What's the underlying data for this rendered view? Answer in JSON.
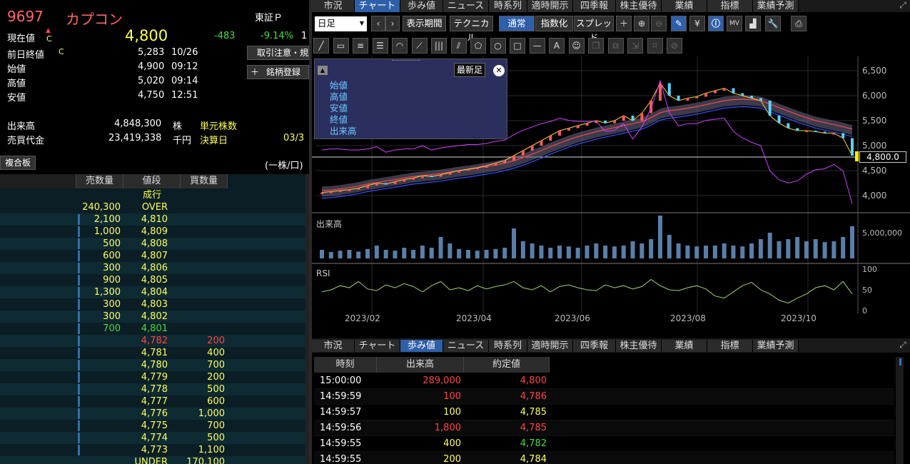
{
  "quote": {
    "code": "9697",
    "name": "カプコン",
    "market": "東証Ｐ",
    "current_label": "現在値",
    "current_marker": "C",
    "current": "4,800",
    "change": "-483",
    "pct": "-9.14%",
    "pct_extra": "1",
    "prev_label": "前日終値",
    "prev_marker": "C",
    "prev": "5,283",
    "prev_date": "10/26",
    "open_label": "始値",
    "open": "4,900",
    "open_time": "09:12",
    "high_label": "高値",
    "high": "5,020",
    "high_time": "09:14",
    "low_label": "安値",
    "low": "4,750",
    "low_time": "12:51",
    "volume_label": "出来高",
    "volume": "4,848,300",
    "volume_unit": "株",
    "unit_label": "単元株数",
    "turnover_label": "売買代金",
    "turnover": "23,419,338",
    "turnover_unit": "千円",
    "fiscal_label": "決算日",
    "fiscal": "03/3"
  },
  "side_buttons": {
    "caution": "取引注意・規",
    "register": "銘柄登録"
  },
  "orderbook": {
    "title": "複合板",
    "unit": "(一株/口)",
    "headers": [
      "売数量",
      "値段",
      "買数量"
    ],
    "market_label": "成行",
    "rows": [
      {
        "sell": "240,300",
        "price": "OVER",
        "buy": "",
        "bar": 0,
        "c": "yl"
      },
      {
        "sell": "2,100",
        "price": "4,810",
        "buy": "",
        "bar": 0.02,
        "c": "yl"
      },
      {
        "sell": "1,000",
        "price": "4,809",
        "buy": "",
        "bar": 0.02,
        "c": "yl"
      },
      {
        "sell": "500",
        "price": "4,808",
        "buy": "",
        "bar": 0.02,
        "c": "yl"
      },
      {
        "sell": "600",
        "price": "4,807",
        "buy": "",
        "bar": 0.02,
        "c": "yl"
      },
      {
        "sell": "300",
        "price": "4,806",
        "buy": "",
        "bar": 0.02,
        "c": "yl"
      },
      {
        "sell": "900",
        "price": "4,805",
        "buy": "",
        "bar": 0.02,
        "c": "yl"
      },
      {
        "sell": "1,300",
        "price": "4,804",
        "buy": "",
        "bar": 0.02,
        "c": "yl"
      },
      {
        "sell": "300",
        "price": "4,803",
        "buy": "",
        "bar": 0.02,
        "c": "yl"
      },
      {
        "sell": "300",
        "price": "4,802",
        "buy": "",
        "bar": 0.02,
        "c": "yl"
      },
      {
        "sell": "700",
        "price": "4,801",
        "buy": "",
        "bar": 0.05,
        "c": "gr"
      },
      {
        "sell": "",
        "price": "4,782",
        "buy": "200",
        "bar": 0.01,
        "c": "rd"
      },
      {
        "sell": "",
        "price": "4,781",
        "buy": "400",
        "bar": 0.02,
        "c": "yl"
      },
      {
        "sell": "",
        "price": "4,780",
        "buy": "700",
        "bar": 0.05,
        "c": "yl"
      },
      {
        "sell": "",
        "price": "4,779",
        "buy": "200",
        "bar": 0.01,
        "c": "yl"
      },
      {
        "sell": "",
        "price": "4,778",
        "buy": "500",
        "bar": 0.02,
        "c": "yl"
      },
      {
        "sell": "",
        "price": "4,777",
        "buy": "600",
        "bar": 0.02,
        "c": "yl"
      },
      {
        "sell": "",
        "price": "4,776",
        "buy": "1,000",
        "bar": 0.02,
        "c": "yl"
      },
      {
        "sell": "",
        "price": "4,775",
        "buy": "700",
        "bar": 0.02,
        "c": "yl"
      },
      {
        "sell": "",
        "price": "4,774",
        "buy": "500",
        "bar": 0.02,
        "c": "yl"
      },
      {
        "sell": "",
        "price": "4,773",
        "buy": "1,100",
        "bar": 0.02,
        "c": "yl"
      },
      {
        "sell": "",
        "price": "UNDER",
        "buy": "170,100",
        "bar": 0,
        "c": "yl"
      }
    ]
  },
  "tabs": [
    "市況",
    "チャート",
    "歩み値",
    "ニュース",
    "時系列",
    "適時開示",
    "四季報",
    "株主優待",
    "業績",
    "指標",
    "業績予測"
  ],
  "chart_toolbar": {
    "period_select": "日足",
    "display_period": "表示期間",
    "technical": "テクニカル",
    "normal": "通常",
    "index": "指数化",
    "spread": "スプレッド"
  },
  "chart_tools": [
    "line",
    "eraser",
    "hlines",
    "hlines2",
    "arc",
    "fan",
    "vlines",
    "channel",
    "pentagon",
    "circle",
    "rect",
    "hline",
    "text",
    "icon",
    "copy",
    "copy2",
    "shift",
    "label",
    "tag"
  ],
  "ohlc_popup": {
    "latest": "最新足",
    "open": "始値",
    "high": "高値",
    "low": "安値",
    "close": "終値",
    "volume": "出来高"
  },
  "chart_data": {
    "type": "line",
    "title": "",
    "y_ticks": [
      "6,500",
      "6,000",
      "5,500",
      "5,000",
      "4,500",
      "4,000"
    ],
    "ylim": [
      4000,
      6500
    ],
    "x_ticks": [
      "2023/02",
      "2023/04",
      "2023/06",
      "2023/08",
      "2023/10"
    ],
    "last_price_tag": "4,800.0",
    "volume_label": "出来高",
    "volume_tick": "5,000,000",
    "rsi_label": "RSI",
    "rsi_ticks": [
      "100",
      "50",
      "0"
    ],
    "series": [
      {
        "values": [
          4060,
          4080,
          4100,
          4120,
          4150,
          4200,
          4250,
          4230,
          4280,
          4320,
          4350,
          4400,
          4380,
          4420,
          4460,
          4500,
          4530,
          4560,
          4600,
          4650,
          4700,
          4800,
          4900,
          5000,
          5100,
          5200,
          5300,
          5350,
          5400,
          5450,
          5500,
          5450,
          5500,
          5600,
          5500,
          5650,
          5900,
          6250,
          6000,
          5900,
          5950,
          5980,
          6050,
          6100,
          6150,
          6050,
          6000,
          5950,
          5900,
          5600,
          5450,
          5350,
          5300,
          5300,
          5280,
          5250,
          5250,
          5150,
          4800
        ]
      },
      {
        "values": [
          4100,
          4110,
          4130,
          4160,
          4190,
          4230,
          4260,
          4290,
          4320,
          4350,
          4380,
          4400,
          4420,
          4440,
          4470,
          4500,
          4520,
          4550,
          4580,
          4610,
          4650,
          4700,
          4760,
          4830,
          4900,
          4980,
          5050,
          5120,
          5180,
          5230,
          5280,
          5320,
          5360,
          5400,
          5440,
          5480,
          5560,
          5660,
          5700,
          5720,
          5750,
          5780,
          5820,
          5860,
          5900,
          5920,
          5930,
          5920,
          5900,
          5830,
          5760,
          5690,
          5620,
          5560,
          5500,
          5460,
          5420,
          5380,
          5330
        ]
      }
    ],
    "volume": [
      0.2,
      0.15,
      0.18,
      0.2,
      0.16,
      0.22,
      0.3,
      0.2,
      0.18,
      0.25,
      0.2,
      0.3,
      0.25,
      0.5,
      0.35,
      0.22,
      0.2,
      0.18,
      0.2,
      0.22,
      0.25,
      0.7,
      0.4,
      0.35,
      0.3,
      0.25,
      0.3,
      0.28,
      0.25,
      0.3,
      0.35,
      0.3,
      0.28,
      0.3,
      0.4,
      0.35,
      0.45,
      1.0,
      0.55,
      0.35,
      0.3,
      0.28,
      0.3,
      0.3,
      0.35,
      0.3,
      0.28,
      0.35,
      0.45,
      0.6,
      0.4,
      0.45,
      0.5,
      0.4,
      0.45,
      0.38,
      0.4,
      0.5,
      0.75
    ],
    "rsi": [
      45,
      50,
      60,
      55,
      70,
      52,
      48,
      62,
      55,
      65,
      58,
      45,
      60,
      70,
      50,
      55,
      48,
      60,
      52,
      58,
      62,
      70,
      55,
      50,
      60,
      45,
      58,
      62,
      55,
      50,
      48,
      62,
      55,
      60,
      52,
      58,
      75,
      60,
      50,
      48,
      55,
      60,
      52,
      35,
      30,
      45,
      60,
      68,
      50,
      40,
      25,
      18,
      30,
      40,
      55,
      60,
      50,
      70,
      40
    ]
  },
  "ayumi": {
    "headers": [
      "時刻",
      "出来高",
      "約定値"
    ],
    "rows": [
      {
        "time": "15:00:00",
        "vol": "289,000",
        "price": "4,800",
        "c": "rd"
      },
      {
        "time": "14:59:59",
        "vol": "100",
        "price": "4,786",
        "c": "rd"
      },
      {
        "time": "14:59:57",
        "vol": "100",
        "price": "4,785",
        "c": "yl"
      },
      {
        "time": "14:59:56",
        "vol": "1,800",
        "price": "4,785",
        "c": "rd"
      },
      {
        "time": "14:59:55",
        "vol": "400",
        "price": "4,782",
        "c": "gr"
      },
      {
        "time": "14:59:55",
        "vol": "200",
        "price": "4,784",
        "c": "yl"
      }
    ]
  }
}
